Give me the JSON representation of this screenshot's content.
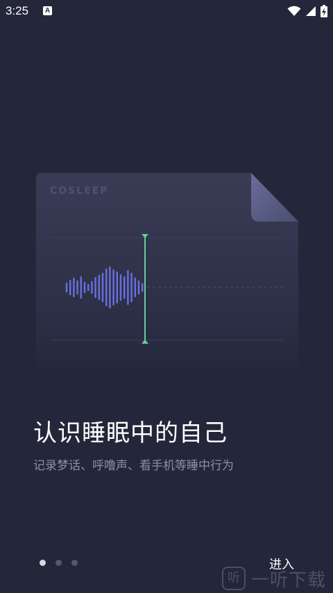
{
  "status_bar": {
    "time": "3:25",
    "notification_badge": "A",
    "icons": [
      "wifi-icon",
      "cellular-signal-icon",
      "battery-charging-icon"
    ]
  },
  "card": {
    "brand": "COSLEEP",
    "accent_color": "#5ed197",
    "wave_color": "#6b6fe0"
  },
  "onboarding": {
    "title": "认识睡眠中的自己",
    "subtitle": "记录梦话、呼噜声、看手机等睡中行为",
    "page_count": 3,
    "active_page": 1
  },
  "actions": {
    "enter_label": "进入"
  },
  "watermark": {
    "logo_glyph": "听",
    "text": "一听下载"
  }
}
